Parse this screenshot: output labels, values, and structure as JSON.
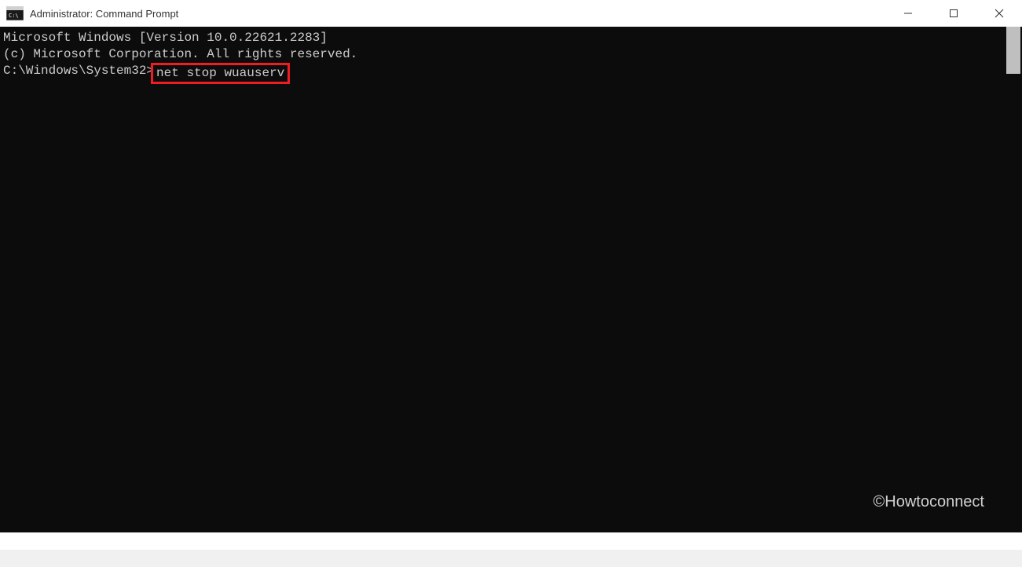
{
  "titlebar": {
    "title": "Administrator: Command Prompt"
  },
  "terminal": {
    "line1": "Microsoft Windows [Version 10.0.22621.2283]",
    "line2": "(c) Microsoft Corporation. All rights reserved.",
    "blank": "",
    "prompt": "C:\\Windows\\System32>",
    "command": "net stop wuauserv"
  },
  "watermark": "©Howtoconnect"
}
